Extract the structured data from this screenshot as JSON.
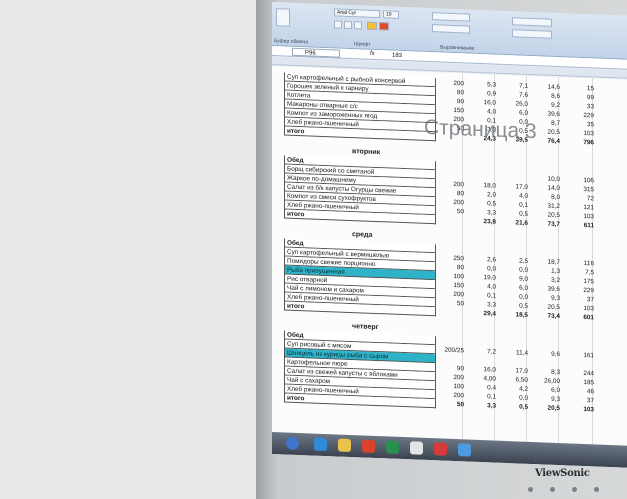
{
  "formula_bar": {
    "cell_ref": "P96",
    "fx": "fx",
    "value": "183"
  },
  "ribbon": {
    "font_name": "Arial Cyr",
    "font_size": "10",
    "groups": [
      "Буфер обмена",
      "Шрифт",
      "Выравнивание"
    ]
  },
  "watermark": "Страница 3",
  "brand": "ViewSonic",
  "blocks": [
    {
      "day": "",
      "rows": [
        {
          "name": "Суп картофельный с рыбной консервой",
          "w": "200",
          "p": "5,3",
          "f": "7,1",
          "c": "14,6",
          "k": "15"
        },
        {
          "name": "Горошек зеленый к гарниру",
          "w": "80",
          "p": "0,9",
          "f": "7,6",
          "c": "8,6",
          "k": "99"
        },
        {
          "name": "Котлета",
          "w": "90",
          "p": "16,0",
          "f": "26,0",
          "c": "9,2",
          "k": "33"
        },
        {
          "name": "Макароны отварные с/с",
          "w": "150",
          "p": "4,0",
          "f": "6,0",
          "c": "39,6",
          "k": "229"
        },
        {
          "name": "Компот из замороженных ягод",
          "w": "200",
          "p": "0,1",
          "f": "0,0",
          "c": "8,7",
          "k": "35"
        },
        {
          "name": "Хлеб ржано-пшеничный",
          "w": "50",
          "p": "3,3",
          "f": "0,5",
          "c": "20,5",
          "k": "103"
        },
        {
          "name": "итого",
          "w": "",
          "p": "24,3",
          "f": "39,5",
          "c": "76,4",
          "k": "796",
          "bold": true
        }
      ]
    },
    {
      "day": "вторник",
      "label": "Обед",
      "rows": [
        {
          "name": "Борщ сибирский со сметаной",
          "w": "",
          "p": "",
          "f": "",
          "c": "10,0",
          "k": "106"
        },
        {
          "name": "Жаркое по-домашнему",
          "w": "200",
          "p": "18,0",
          "f": "17,0",
          "c": "14,0",
          "k": "315"
        },
        {
          "name": "Салат из б/к капусты Огурцы свежие",
          "w": "80",
          "p": "2,0",
          "f": "4,0",
          "c": "8,0",
          "k": "72"
        },
        {
          "name": "Компот из смеси сухофруктов",
          "w": "200",
          "p": "0,5",
          "f": "0,1",
          "c": "31,2",
          "k": "121"
        },
        {
          "name": "Хлеб ржано-пшеничный",
          "w": "50",
          "p": "3,3",
          "f": "0,5",
          "c": "20,5",
          "k": "103"
        },
        {
          "name": "итого",
          "w": "",
          "p": "23,8",
          "f": "21,6",
          "c": "73,7",
          "k": "611",
          "bold": true
        }
      ]
    },
    {
      "day": "среда",
      "label": "Обед",
      "rows": [
        {
          "name": "Суп картофельный с вермишелью",
          "w": "250",
          "p": "2,6",
          "f": "2,5",
          "c": "18,7",
          "k": "116"
        },
        {
          "name": "Помидоры свежие порционно",
          "w": "80",
          "p": "0,0",
          "f": "0,0",
          "c": "1,3",
          "k": "7,5"
        },
        {
          "name": "Рыба припущенная",
          "w": "100",
          "p": "19,0",
          "f": "9,0",
          "c": "3,2",
          "k": "175",
          "hl": true
        },
        {
          "name": "Рис отварной",
          "w": "150",
          "p": "4,0",
          "f": "6,0",
          "c": "39,6",
          "k": "229"
        },
        {
          "name": "Чай с лимоном и сахаром",
          "w": "200",
          "p": "0,1",
          "f": "0,0",
          "c": "9,3",
          "k": "37"
        },
        {
          "name": "Хлеб ржано-пшеничный",
          "w": "50",
          "p": "3,3",
          "f": "0,5",
          "c": "20,5",
          "k": "103"
        },
        {
          "name": "итого",
          "w": "",
          "p": "29,4",
          "f": "18,5",
          "c": "73,4",
          "k": "601",
          "bold": true
        }
      ]
    },
    {
      "day": "четверг",
      "label": "Обед",
      "rows": [
        {
          "name": "Суп рисовый с мясом",
          "w": "200/25",
          "p": "7,2",
          "f": "11,4",
          "c": "9,6",
          "k": "161"
        },
        {
          "name": "Шницель из курицы рыба с сыром",
          "w": "",
          "p": "",
          "f": "",
          "c": "",
          "k": "",
          "hl": true
        },
        {
          "name": "Картофельное пюре",
          "w": "90",
          "p": "16,0",
          "f": "17,0",
          "c": "8,3",
          "k": "244"
        },
        {
          "name": "Салат из свежей капусты с яблоками",
          "w": "200",
          "p": "4,00",
          "f": "6,50",
          "c": "26,00",
          "k": "185"
        },
        {
          "name": "Чай с сахаром",
          "w": "100",
          "p": "0,4",
          "f": "4,2",
          "c": "6,0",
          "k": "46"
        },
        {
          "name": "Хлеб ржано-пшеничный",
          "w": "200",
          "p": "0,1",
          "f": "0,0",
          "c": "9,3",
          "k": "37"
        },
        {
          "name": "итого",
          "w": "50",
          "p": "3,3",
          "f": "0,5",
          "c": "20,5",
          "k": "103",
          "bold": true
        }
      ]
    }
  ]
}
